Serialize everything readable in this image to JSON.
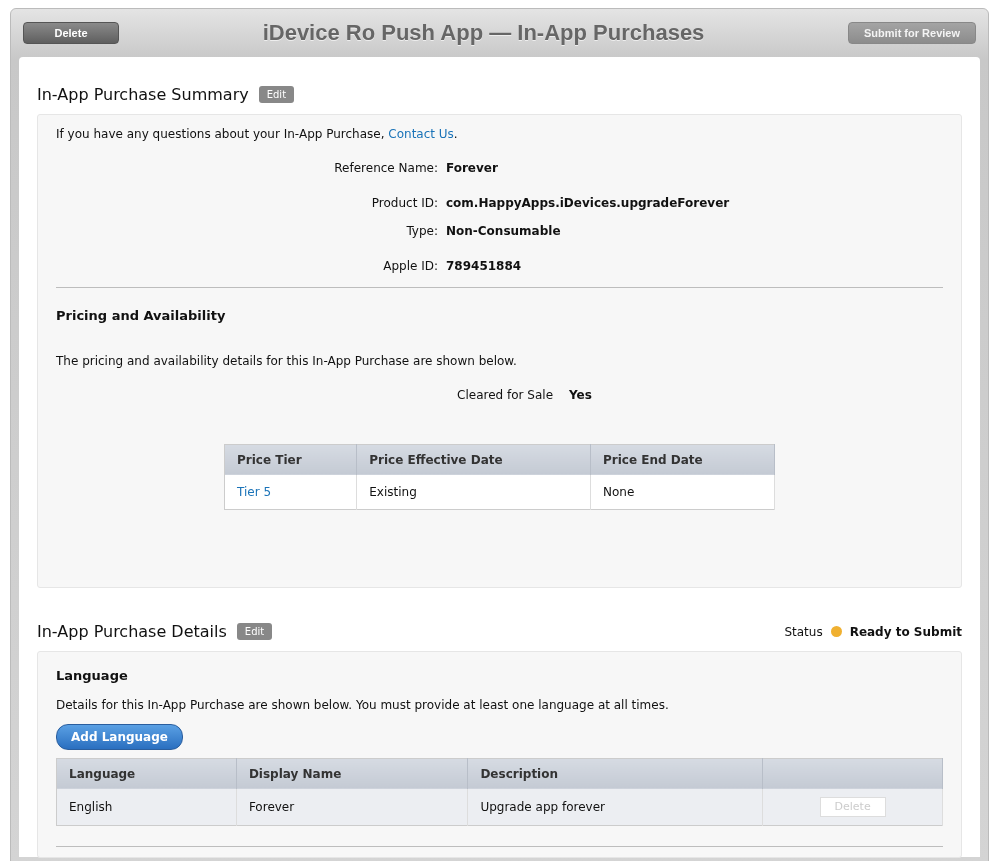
{
  "header": {
    "delete_button": "Delete",
    "title": "iDevice Ro Push App — In-App Purchases",
    "submit_button": {
      "label": "Submit for Review",
      "disabled": true
    }
  },
  "summary": {
    "title": "In-App Purchase Summary",
    "edit": "Edit",
    "intro": {
      "before": "If you have any questions about your In-App Purchase, ",
      "link": "Contact Us",
      "after": "."
    },
    "fields": [
      {
        "label": "Reference Name:",
        "value": "Forever"
      },
      {
        "label": "Product ID:",
        "value": "com.HappyApps.iDevices.upgradeForever"
      },
      {
        "label": "Type:",
        "value": "Non-Consumable"
      },
      {
        "label": "Apple ID:",
        "value": "789451884"
      }
    ],
    "pricing": {
      "title": "Pricing and Availability",
      "text": "The pricing and availability details for this In-App Purchase are shown below.",
      "cleared_label": "Cleared for Sale",
      "cleared_value": "Yes",
      "table": {
        "columns": [
          "Price Tier",
          "Price Effective Date",
          "Price End Date"
        ],
        "rows": [
          [
            "Tier 5",
            "Existing",
            "None"
          ]
        ]
      }
    }
  },
  "details": {
    "title": "In-App Purchase Details",
    "edit": "Edit",
    "status": {
      "label": "Status",
      "value": "Ready to Submit",
      "color": "#f0b030"
    },
    "language": {
      "title": "Language",
      "text": "Details for this In-App Purchase are shown below. You must provide at least one language at all times.",
      "add_button": "Add Language",
      "table": {
        "columns": [
          "Language",
          "Display Name",
          "Description"
        ],
        "rows": [
          {
            "language": "English",
            "display_name": "Forever",
            "description": "Upgrade app forever",
            "delete": "Delete",
            "delete_disabled": true
          }
        ]
      }
    }
  }
}
